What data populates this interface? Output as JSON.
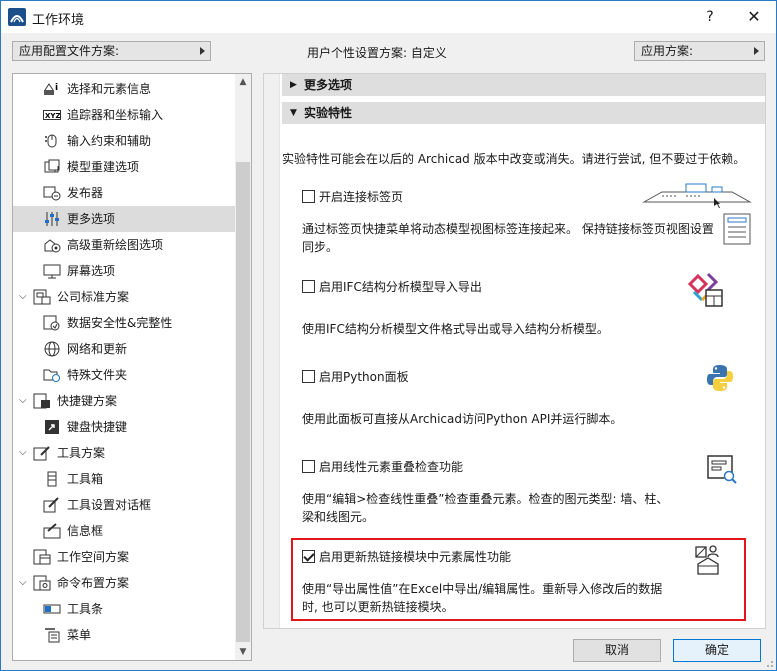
{
  "window": {
    "title": "工作环境",
    "help_label": "?",
    "close_label": "✕"
  },
  "topbar": {
    "profile_scheme": "应用配置文件方案:",
    "user_scheme": "用户个性设置方案: 自定义",
    "apply_scheme": "应用方案:"
  },
  "tree": {
    "items": [
      {
        "label": "选择和元素信息",
        "icon": "selection-info-icon"
      },
      {
        "label": "追踪器和坐标输入",
        "icon": "xyz-tracker-icon"
      },
      {
        "label": "输入约束和辅助",
        "icon": "mouse-constraint-icon"
      },
      {
        "label": "模型重建选项",
        "icon": "model-rebuild-icon"
      },
      {
        "label": "发布器",
        "icon": "publisher-icon"
      },
      {
        "label": "更多选项",
        "icon": "sliders-icon"
      },
      {
        "label": "高级重新绘图选项",
        "icon": "redraw-icon"
      },
      {
        "label": "屏幕选项",
        "icon": "monitor-icon"
      },
      {
        "label": "公司标准方案",
        "icon": "company-standards-icon"
      },
      {
        "label": "数据安全性&完整性",
        "icon": "data-safety-icon"
      },
      {
        "label": "网络和更新",
        "icon": "globe-icon"
      },
      {
        "label": "特殊文件夹",
        "icon": "folder-icon"
      },
      {
        "label": "快捷键方案",
        "icon": "shortcut-scheme-icon"
      },
      {
        "label": "键盘快捷键",
        "icon": "keyboard-shortcut-icon"
      },
      {
        "label": "工具方案",
        "icon": "tool-scheme-icon"
      },
      {
        "label": "工具箱",
        "icon": "toolbox-icon"
      },
      {
        "label": "工具设置对话框",
        "icon": "tool-settings-icon"
      },
      {
        "label": "信息框",
        "icon": "info-box-icon"
      },
      {
        "label": "工作空间方案",
        "icon": "workspace-icon"
      },
      {
        "label": "命令布置方案",
        "icon": "command-layout-icon"
      },
      {
        "label": "工具条",
        "icon": "toolbar-icon"
      },
      {
        "label": "菜单",
        "icon": "menu-icon"
      }
    ]
  },
  "sections": {
    "more_options": "更多选项",
    "experimental": "实验特性",
    "intro": "实验特性可能会在以后的 Archicad 版本中改变或消失。请进行尝试, 但不要过于依赖。"
  },
  "features": [
    {
      "title": "开启连接标签页",
      "checked": false,
      "desc1": "通过标签页快捷菜单将动态模型视图标签连接起来。 保持链接标签页视图设置",
      "desc2": "同步。",
      "icon": "connected-tabs-icon"
    },
    {
      "title": "启用IFC结构分析模型导入导出",
      "checked": false,
      "desc1": "使用IFC结构分析模型文件格式导出或导入结构分析模型。",
      "desc2": "",
      "icon": "ifc-structural-icon"
    },
    {
      "title": "启用Python面板",
      "checked": false,
      "desc1": "使用此面板可直接从Archicad访问Python API并运行脚本。",
      "desc2": "",
      "icon": "python-icon"
    },
    {
      "title": "启用线性元素重叠检查功能",
      "checked": false,
      "desc1": "使用“编辑>检查线性重叠”检查重叠元素。检查的图元类型: 墙、柱、",
      "desc2": "梁和线图元。",
      "icon": "overlap-check-icon"
    },
    {
      "title": "启用更新热链接模块中元素属性功能",
      "checked": true,
      "desc1": "使用“导出属性值”在Excel中导出/编辑属性。重新导入修改后的数据",
      "desc2": "时, 也可以更新热链接模块。",
      "icon": "hotlink-update-icon"
    }
  ],
  "buttons": {
    "cancel": "取消",
    "ok": "确定"
  },
  "colors": {
    "accent": "#0078d7",
    "highlight": "#e3141c",
    "selected": "#dcdcdc"
  }
}
